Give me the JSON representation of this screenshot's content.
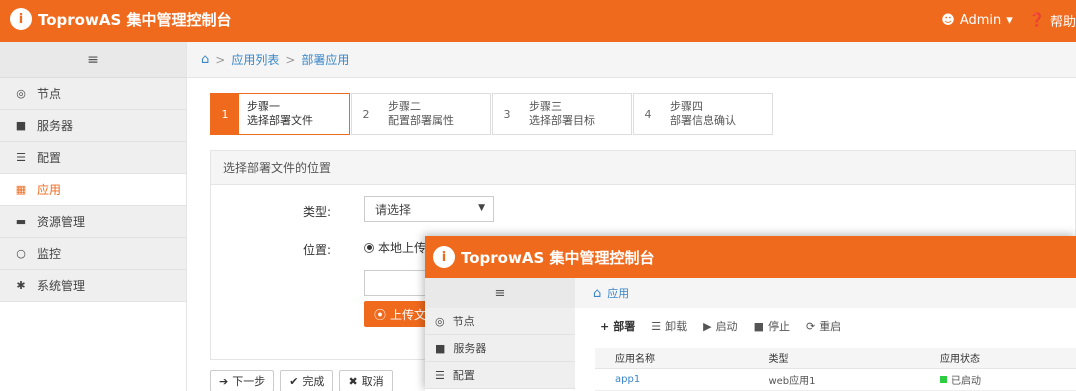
{
  "app": {
    "title": "ToprowAS 集中管理控制台",
    "logo_icon": "circle-i-icon",
    "user_label": "Admin",
    "help_label": "帮助",
    "accent_color": "#f06a1d"
  },
  "sidebar": {
    "toggle": "≡",
    "items": [
      {
        "label": "节点",
        "icon": "◎"
      },
      {
        "label": "服务器",
        "icon": "■"
      },
      {
        "label": "配置",
        "icon": "☰"
      },
      {
        "label": "应用",
        "icon": "▦"
      },
      {
        "label": "资源管理",
        "icon": "▬"
      },
      {
        "label": "监控",
        "icon": "○"
      },
      {
        "label": "系统管理",
        "icon": "✱"
      }
    ]
  },
  "breadcrumb": {
    "home_icon": "home-icon",
    "items": [
      "应用列表",
      "部署应用"
    ]
  },
  "steps": [
    {
      "num": "1",
      "line1": "步骤一",
      "line2": "选择部署文件"
    },
    {
      "num": "2",
      "line1": "步骤二",
      "line2": "配置部署属性"
    },
    {
      "num": "3",
      "line1": "步骤三",
      "line2": "选择部署目标"
    },
    {
      "num": "4",
      "line1": "步骤四",
      "line2": "部署信息确认"
    }
  ],
  "panel": {
    "title": "选择部署文件的位置",
    "type_label": "类型:",
    "type_value": "请选择",
    "location_label": "位置:",
    "radio_label": "本地上传",
    "upload_button": "上传文"
  },
  "buttons": {
    "next": "下一步",
    "finish": "完成",
    "cancel": "取消"
  },
  "overlay": {
    "title": "ToprowAS 集中管理控制台",
    "sidebar_toggle": "≡",
    "sidebar_items": [
      {
        "label": "节点",
        "icon": "◎"
      },
      {
        "label": "服务器",
        "icon": "■"
      },
      {
        "label": "配置",
        "icon": "☰"
      }
    ],
    "breadcrumb": "应用",
    "toolbar": [
      {
        "label": "部署",
        "icon": "+"
      },
      {
        "label": "卸载",
        "icon": "☰"
      },
      {
        "label": "启动",
        "icon": "▶"
      },
      {
        "label": "停止",
        "icon": "■"
      },
      {
        "label": "重启",
        "icon": "⟳"
      }
    ],
    "table": {
      "headers": [
        "应用名称",
        "类型",
        "应用状态"
      ],
      "rows": [
        {
          "name": "app1",
          "type": "web应用1",
          "status": "已启动"
        }
      ]
    }
  }
}
